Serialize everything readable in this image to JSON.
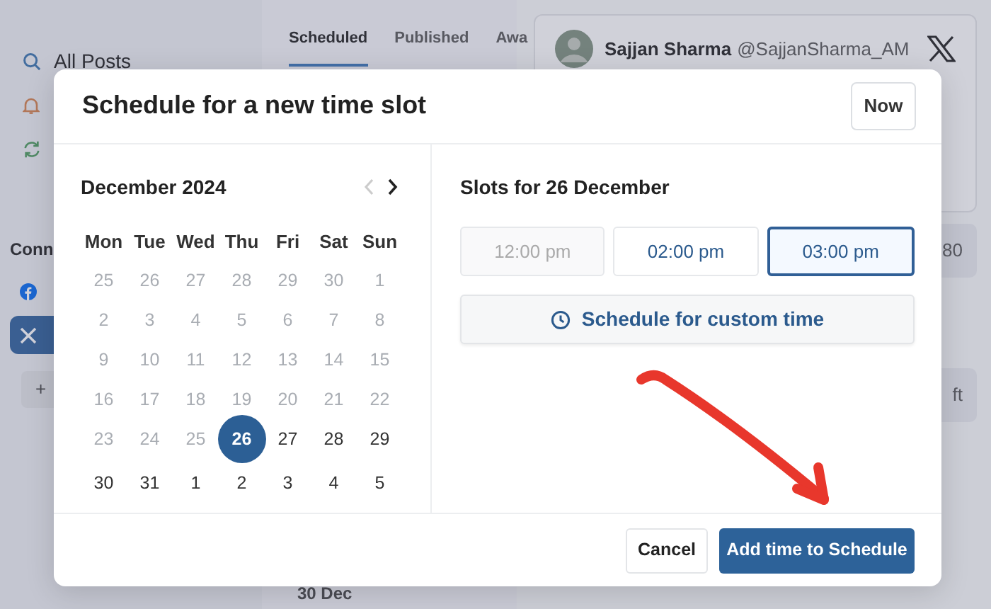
{
  "sidebar": {
    "items": [
      {
        "label": "All Posts"
      }
    ],
    "section_title": "Conn",
    "accounts": [
      {
        "selected": false
      },
      {
        "selected": true
      }
    ],
    "add_button": "+"
  },
  "tabs": [
    {
      "label": "Scheduled",
      "selected": true
    },
    {
      "label": "Published",
      "selected": false
    },
    {
      "label": "Awa",
      "selected": false
    }
  ],
  "date_heading": "30 Dec",
  "post_card": {
    "name": "Sajjan Sharma",
    "handle": "@SajjanSharma_AM"
  },
  "side_buttons": [
    "80",
    "ft"
  ],
  "modal": {
    "title": "Schedule for a new time slot",
    "now_button": "Now",
    "calendar": {
      "month": "December 2024",
      "prev_disabled": true,
      "weekdays": [
        "Mon",
        "Tue",
        "Wed",
        "Thu",
        "Fri",
        "Sat",
        "Sun"
      ],
      "days": [
        {
          "label": "25",
          "muted": true,
          "selected": false
        },
        {
          "label": "26",
          "muted": true,
          "selected": false
        },
        {
          "label": "27",
          "muted": true,
          "selected": false
        },
        {
          "label": "28",
          "muted": true,
          "selected": false
        },
        {
          "label": "29",
          "muted": true,
          "selected": false
        },
        {
          "label": "30",
          "muted": true,
          "selected": false
        },
        {
          "label": "1",
          "muted": true,
          "selected": false
        },
        {
          "label": "2",
          "muted": true,
          "selected": false
        },
        {
          "label": "3",
          "muted": true,
          "selected": false
        },
        {
          "label": "4",
          "muted": true,
          "selected": false
        },
        {
          "label": "5",
          "muted": true,
          "selected": false
        },
        {
          "label": "6",
          "muted": true,
          "selected": false
        },
        {
          "label": "7",
          "muted": true,
          "selected": false
        },
        {
          "label": "8",
          "muted": true,
          "selected": false
        },
        {
          "label": "9",
          "muted": true,
          "selected": false
        },
        {
          "label": "10",
          "muted": true,
          "selected": false
        },
        {
          "label": "11",
          "muted": true,
          "selected": false
        },
        {
          "label": "12",
          "muted": true,
          "selected": false
        },
        {
          "label": "13",
          "muted": true,
          "selected": false
        },
        {
          "label": "14",
          "muted": true,
          "selected": false
        },
        {
          "label": "15",
          "muted": true,
          "selected": false
        },
        {
          "label": "16",
          "muted": true,
          "selected": false
        },
        {
          "label": "17",
          "muted": true,
          "selected": false
        },
        {
          "label": "18",
          "muted": true,
          "selected": false
        },
        {
          "label": "19",
          "muted": true,
          "selected": false
        },
        {
          "label": "20",
          "muted": true,
          "selected": false
        },
        {
          "label": "21",
          "muted": true,
          "selected": false
        },
        {
          "label": "22",
          "muted": true,
          "selected": false
        },
        {
          "label": "23",
          "muted": true,
          "selected": false
        },
        {
          "label": "24",
          "muted": true,
          "selected": false
        },
        {
          "label": "25",
          "muted": true,
          "selected": false
        },
        {
          "label": "26",
          "muted": false,
          "selected": true
        },
        {
          "label": "27",
          "muted": false,
          "selected": false
        },
        {
          "label": "28",
          "muted": false,
          "selected": false
        },
        {
          "label": "29",
          "muted": false,
          "selected": false
        },
        {
          "label": "30",
          "muted": false,
          "selected": false
        },
        {
          "label": "31",
          "muted": false,
          "selected": false
        },
        {
          "label": "1",
          "muted": false,
          "selected": false
        },
        {
          "label": "2",
          "muted": false,
          "selected": false
        },
        {
          "label": "3",
          "muted": false,
          "selected": false
        },
        {
          "label": "4",
          "muted": false,
          "selected": false
        },
        {
          "label": "5",
          "muted": false,
          "selected": false
        }
      ]
    },
    "slots_title": "Slots for 26 December",
    "slots": [
      {
        "label": "12:00 pm",
        "disabled": true,
        "selected": false
      },
      {
        "label": "02:00 pm",
        "disabled": false,
        "selected": false
      },
      {
        "label": "03:00 pm",
        "disabled": false,
        "selected": true
      }
    ],
    "custom_button": "Schedule for custom time",
    "cancel_button": "Cancel",
    "confirm_button": "Add time to Schedule"
  }
}
